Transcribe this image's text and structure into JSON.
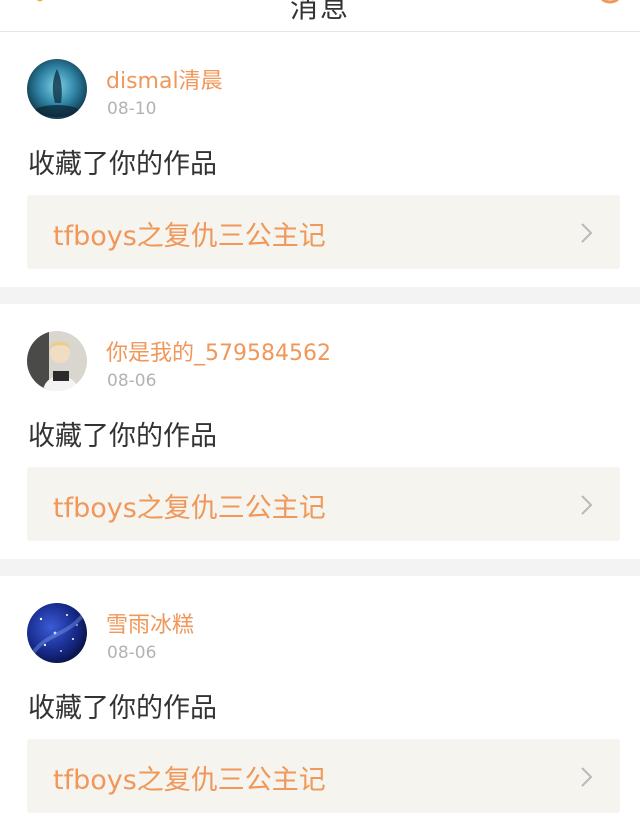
{
  "header": {
    "title": "消息"
  },
  "notifications": [
    {
      "username": "dismal清晨",
      "date": "08-10",
      "action": "收藏了你的作品",
      "work_title": "tfboys之复仇三公主记"
    },
    {
      "username": "你是我的_579584562",
      "date": "08-06",
      "action": "收藏了你的作品",
      "work_title": "tfboys之复仇三公主记"
    },
    {
      "username": "雪雨冰糕",
      "date": "08-06",
      "action": "收藏了你的作品",
      "work_title": "tfboys之复仇三公主记"
    }
  ],
  "colors": {
    "accent": "#f0975a",
    "text": "#333333",
    "muted": "#b3b3b3",
    "card_link_bg": "#f5f4ee",
    "separator": "#f3f3f3"
  }
}
